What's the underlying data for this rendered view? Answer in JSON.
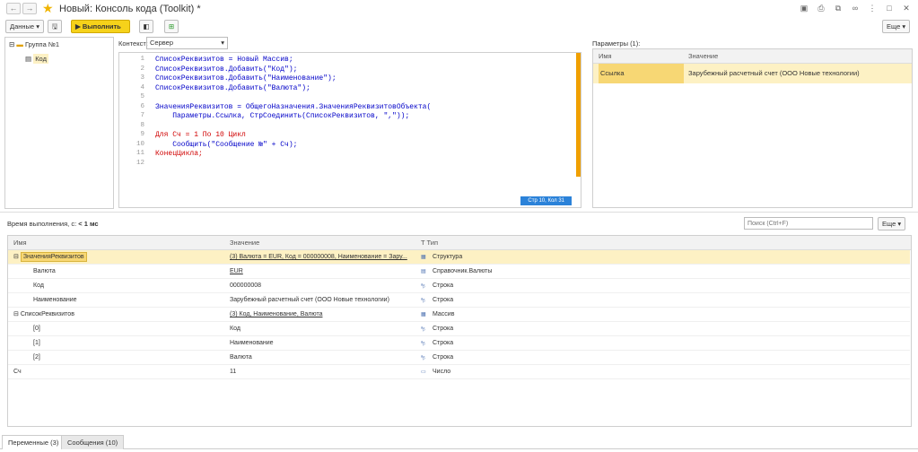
{
  "window": {
    "title": "Новый: Консоль кода (Toolkit) *"
  },
  "toolbar": {
    "data_label": "Данные",
    "run_label": "Выполнить",
    "more_label": "Еще"
  },
  "tree": {
    "group": "Группа №1",
    "item": "Код"
  },
  "context": {
    "label": "Контекст:",
    "value": "Сервер"
  },
  "editor": {
    "lines": [
      "1",
      "2",
      "3",
      "4",
      "5",
      "6",
      "7",
      "8",
      "9",
      "10",
      "11",
      "12"
    ],
    "code": [
      "СписокРеквизитов = Новый Массив;",
      "СписокРеквизитов.Добавить(\"Код\");",
      "СписокРеквизитов.Добавить(\"Наименование\");",
      "СписокРеквизитов.Добавить(\"Валюта\");",
      "",
      "ЗначенияРеквизитов = ОбщегоНазначения.ЗначенияРеквизитовОбъекта(",
      "    Параметры.Ссылка, СтрСоединить(СписокРеквизитов, \",\"));",
      "",
      "Для Сч = 1 По 10 Цикл",
      "    Сообщить(\"Сообщение №\" + Сч);",
      "КонецЦикла;",
      ""
    ],
    "status": "Стр 10, Кол 31"
  },
  "params": {
    "title": "Параметры (1):",
    "col_name": "Имя",
    "col_value": "Значение",
    "row_name": "Ссылка",
    "row_value": "Зарубежный расчетный счет (ООО Новые технологии)"
  },
  "bottom": {
    "time_label": "Время выполнения, с:",
    "time_value": "< 1 мс",
    "search_placeholder": "Поиск (Ctrl+F)",
    "more_label": "Еще",
    "col_name": "Имя",
    "col_value": "Значение",
    "col_type": "Тип",
    "rows": [
      {
        "name": "ЗначенияРеквизитов",
        "value": "(3) Валюта = EUR, Код = 000000008, Наименование = Зару...",
        "type": "Структура"
      },
      {
        "name": "Валюта",
        "value": "EUR",
        "type": "Справочник.Валюты"
      },
      {
        "name": "Код",
        "value": "000000008",
        "type": "Строка"
      },
      {
        "name": "Наименование",
        "value": "Зарубежный расчетный счет (ООО Новые технологии)",
        "type": "Строка"
      },
      {
        "name": "СписокРеквизитов",
        "value": "(3) Код, Наименование, Валюта",
        "type": "Массив"
      },
      {
        "name": "[0]",
        "value": "Код",
        "type": "Строка"
      },
      {
        "name": "[1]",
        "value": "Наименование",
        "type": "Строка"
      },
      {
        "name": "[2]",
        "value": "Валюта",
        "type": "Строка"
      },
      {
        "name": "Сч",
        "value": "11",
        "type": "Число"
      }
    ]
  },
  "tabs": {
    "variables": "Переменные (3)",
    "messages": "Сообщения (10)"
  }
}
